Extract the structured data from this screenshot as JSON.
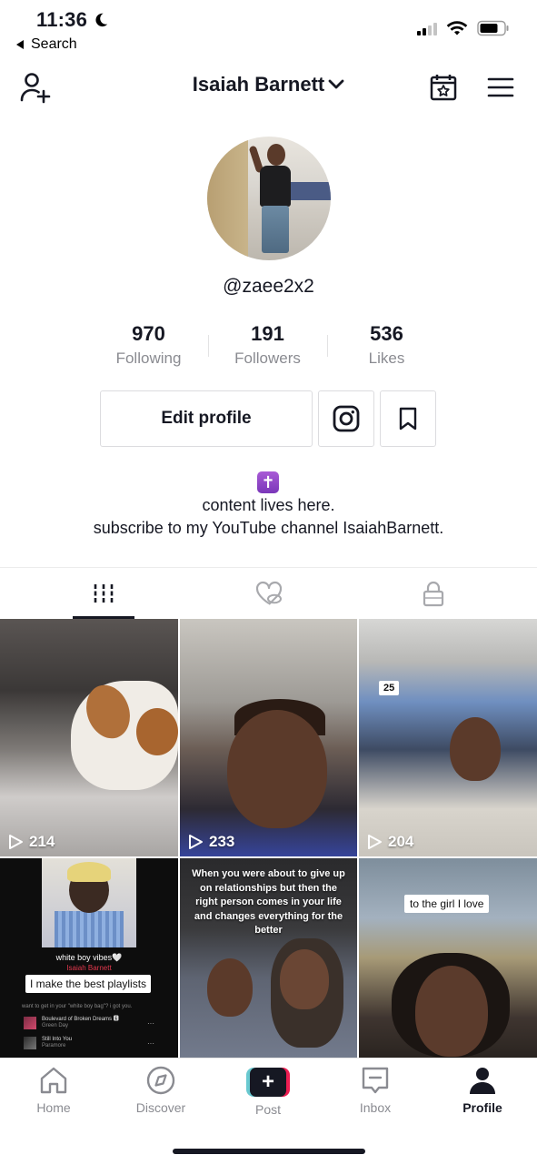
{
  "status_bar": {
    "time": "11:36",
    "back_label": "Search"
  },
  "header": {
    "title": "Isaiah Barnett",
    "icons": [
      "add-friend-icon",
      "calendar-star-icon",
      "menu-icon"
    ]
  },
  "profile": {
    "username": "@zaee2x2",
    "stats": [
      {
        "value": "970",
        "label": "Following"
      },
      {
        "value": "191",
        "label": "Followers"
      },
      {
        "value": "536",
        "label": "Likes"
      }
    ],
    "edit_profile_label": "Edit profile",
    "bio_emoji": "✝",
    "bio_line_1": "content lives here.",
    "bio_line_2": "subscribe to my YouTube channel IsaiahBarnett."
  },
  "tabs": [
    {
      "icon": "grid-icon",
      "active": true
    },
    {
      "icon": "liked-hidden-icon",
      "active": false
    },
    {
      "icon": "lock-icon",
      "active": false
    }
  ],
  "videos": [
    {
      "views": "214"
    },
    {
      "views": "233"
    },
    {
      "views": "204",
      "badge": "25"
    },
    {
      "caption": "I make the best playlists",
      "title": "white boy vibes🤍",
      "subtitle": "Isaiah Barnett",
      "small_text": "want to get in your \"white boy bag\"? i got you.",
      "songs": [
        {
          "name": "Boulevard of Broken Dreams 🅴",
          "artist": "Green Day"
        },
        {
          "name": "Still Into You",
          "artist": "Paramore"
        }
      ]
    },
    {
      "caption": "When you were about to give up on relationships but then the right person comes in your life and changes everything for the better"
    },
    {
      "caption": "to the girl I love"
    }
  ],
  "bottom_nav": [
    {
      "label": "Home",
      "icon": "home-icon",
      "active": false
    },
    {
      "label": "Discover",
      "icon": "compass-icon",
      "active": false
    },
    {
      "label": "Post",
      "icon": "plus-icon",
      "active": false
    },
    {
      "label": "Inbox",
      "icon": "inbox-icon",
      "active": false
    },
    {
      "label": "Profile",
      "icon": "profile-icon",
      "active": true
    }
  ],
  "colors": {
    "text": "#161823",
    "muted": "#8a8b91",
    "accent_pink": "#ee1d52",
    "accent_cyan": "#69c9d0"
  }
}
